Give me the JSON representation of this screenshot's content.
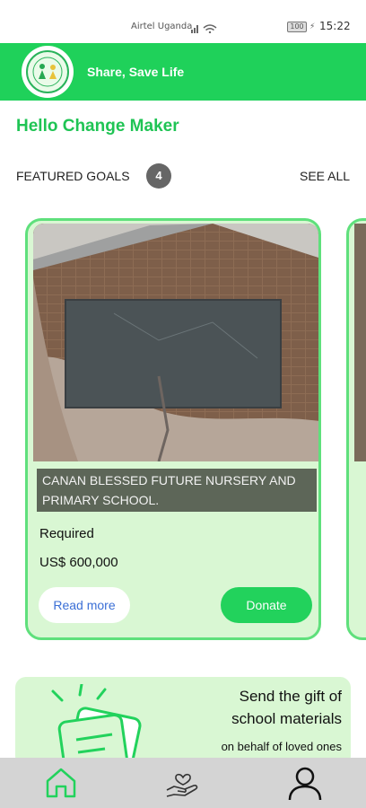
{
  "status_bar": {
    "carrier": "Airtel Uganda",
    "battery": "100",
    "time": "15:22"
  },
  "header": {
    "tagline": "Share, Save Life",
    "brand_color": "#1fd15a"
  },
  "greeting": "Hello Change Maker",
  "featured": {
    "label": "FEATURED GOALS",
    "count": "4",
    "see_all": "SEE ALL"
  },
  "cards": [
    {
      "title": "CANAN BLESSED FUTURE NURSERY AND PRIMARY SCHOOL.",
      "required_label": "Required",
      "amount": "US$ 600,000",
      "read_more": "Read more",
      "donate": "Donate"
    }
  ],
  "promo": {
    "line1": "Send the gift of",
    "line2": "school materials",
    "line3": "on behalf of loved ones"
  },
  "nav": {
    "items": [
      {
        "icon": "home-icon",
        "active": true
      },
      {
        "icon": "donate-hand-heart-icon",
        "active": false
      },
      {
        "icon": "profile-icon",
        "active": false
      }
    ]
  }
}
